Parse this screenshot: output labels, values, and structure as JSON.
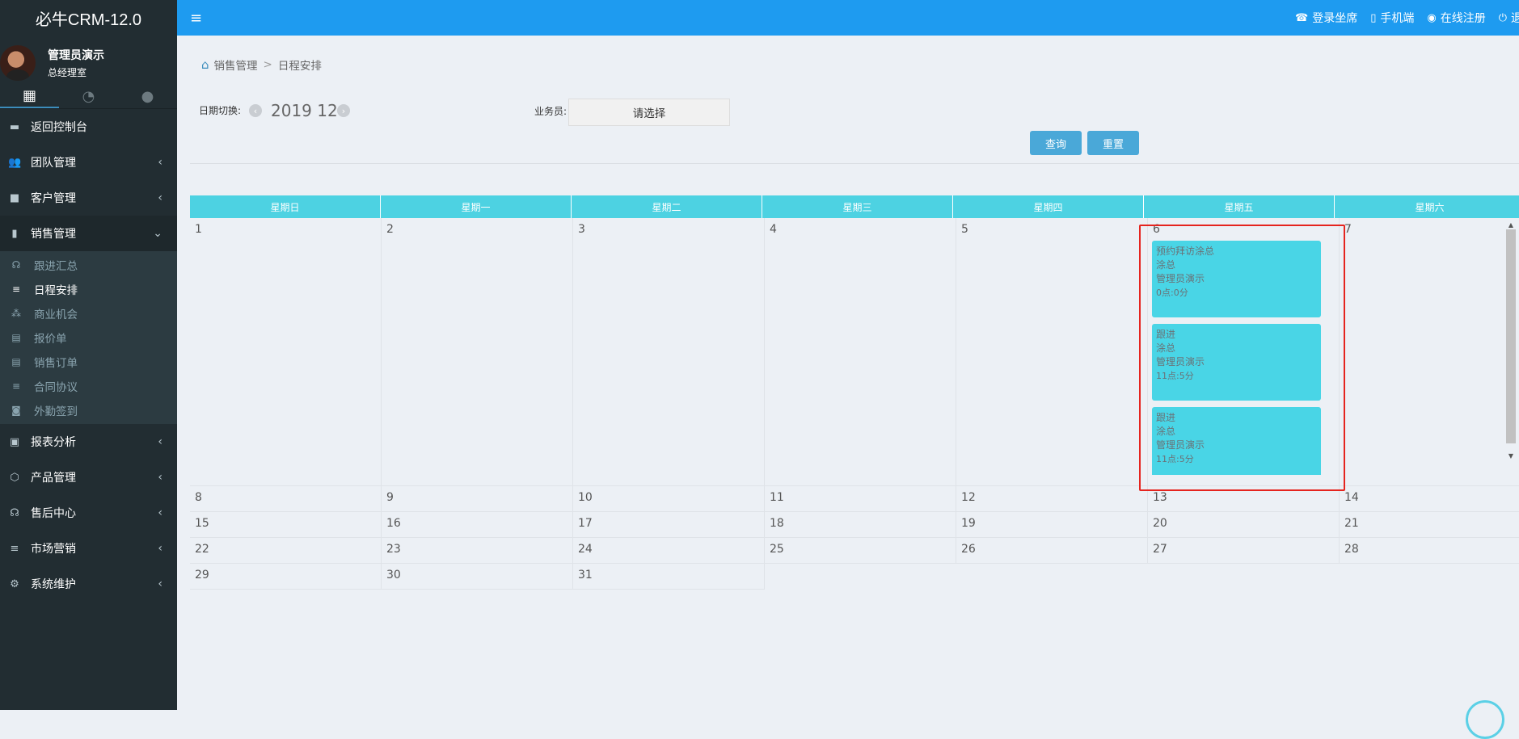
{
  "app": {
    "title": "必牛CRM-12.0"
  },
  "user": {
    "name": "管理员演示",
    "role": "总经理室"
  },
  "sidebar": {
    "tabs": [
      {
        "icon": "dashboard-grid-icon"
      },
      {
        "icon": "pie-chart-icon"
      },
      {
        "icon": "chat-bubble-icon"
      }
    ],
    "items": [
      {
        "label": "返回控制台",
        "icon": "monitor-icon"
      },
      {
        "label": "团队管理",
        "icon": "users-icon"
      },
      {
        "label": "客户管理",
        "icon": "customer-card-icon"
      },
      {
        "label": "销售管理",
        "icon": "bar-chart-icon"
      },
      {
        "label": "报表分析",
        "icon": "report-icon"
      },
      {
        "label": "产品管理",
        "icon": "cube-icon"
      },
      {
        "label": "售后中心",
        "icon": "headset-icon"
      },
      {
        "label": "市场营销",
        "icon": "list-icon"
      },
      {
        "label": "系统维护",
        "icon": "gear-icon"
      }
    ],
    "sales_sub": [
      {
        "label": "跟进汇总"
      },
      {
        "label": "日程安排"
      },
      {
        "label": "商业机会"
      },
      {
        "label": "报价单"
      },
      {
        "label": "销售订单"
      },
      {
        "label": "合同协议"
      },
      {
        "label": "外勤签到"
      }
    ]
  },
  "topbar": {
    "links": [
      {
        "label": "登录坐席",
        "icon": "phone-icon"
      },
      {
        "label": "手机端",
        "icon": "mobile-icon"
      },
      {
        "label": "在线注册",
        "icon": "register-icon"
      },
      {
        "label": "退出",
        "icon": "power-icon"
      }
    ]
  },
  "breadcrumb": {
    "parent": "销售管理",
    "current": "日程安排",
    "separator": ">"
  },
  "filters": {
    "date_label": "日期切换:",
    "date_value": "2019 12",
    "rep_label": "业务员:",
    "rep_placeholder": "请选择",
    "query_button": "查询",
    "reset_button": "重置"
  },
  "calendar": {
    "weekdays": [
      "星期日",
      "星期一",
      "星期二",
      "星期三",
      "星期四",
      "星期五",
      "星期六"
    ],
    "weeks": [
      [
        "1",
        "2",
        "3",
        "4",
        "5",
        "6",
        "7"
      ],
      [
        "8",
        "9",
        "10",
        "11",
        "12",
        "13",
        "14"
      ],
      [
        "15",
        "16",
        "17",
        "18",
        "19",
        "20",
        "21"
      ],
      [
        "22",
        "23",
        "24",
        "25",
        "26",
        "27",
        "28"
      ],
      [
        "29",
        "30",
        "31",
        "",
        "",
        "",
        ""
      ]
    ],
    "events": [
      {
        "title": "预约拜访涂总",
        "contact": "涂总",
        "owner": "管理员演示",
        "time": "0点:0分"
      },
      {
        "title": "跟进",
        "contact": "涂总",
        "owner": "管理员演示",
        "time": "11点:5分"
      },
      {
        "title": "跟进",
        "contact": "涂总",
        "owner": "管理员演示",
        "time": "11点:5分"
      }
    ]
  },
  "colors": {
    "topbar": "#1e9bf0",
    "sidebar": "#222d32",
    "calendar_header": "#4dd2e2",
    "event": "#49d5e6",
    "highlight": "#e5241e",
    "button": "#4aa8d8"
  }
}
